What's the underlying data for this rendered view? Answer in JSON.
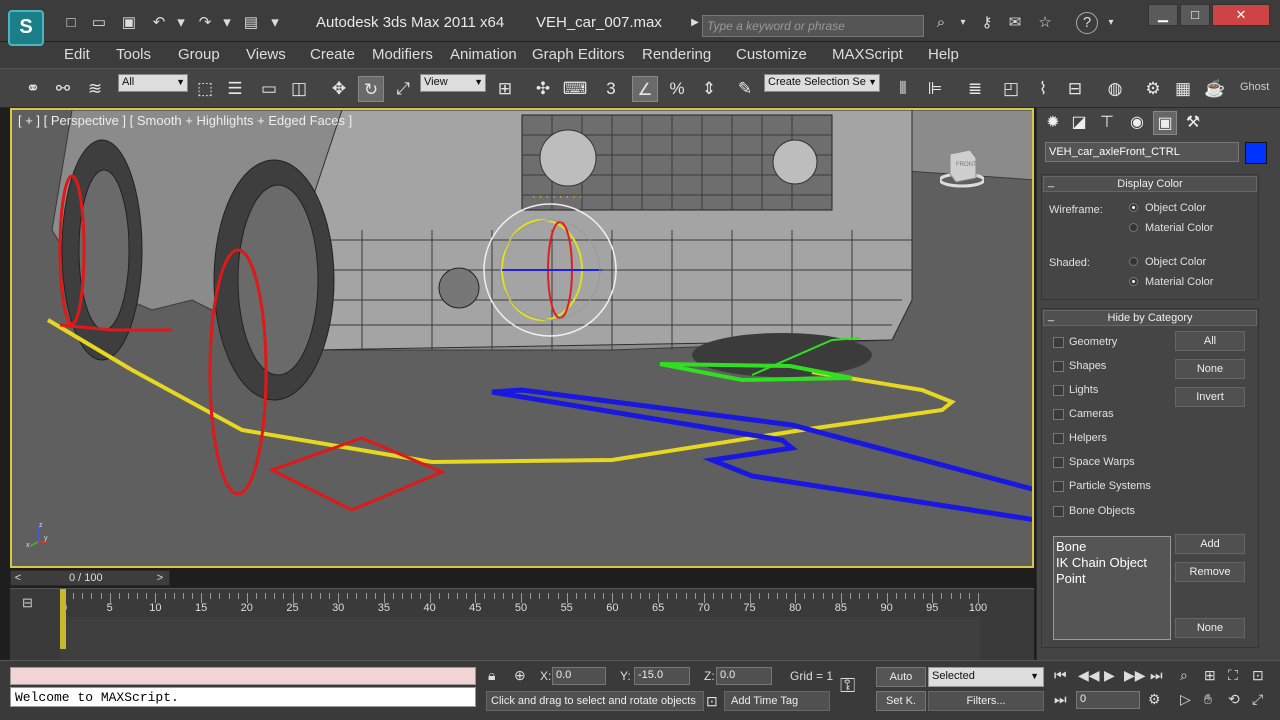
{
  "titlebar": {
    "app_logo": "S",
    "app_title": "Autodesk 3ds Max  2011 x64",
    "file_name": "VEH_car_007.max",
    "search_placeholder": "Type a keyword or phrase"
  },
  "menu": [
    "Edit",
    "Tools",
    "Group",
    "Views",
    "Create",
    "Modifiers",
    "Animation",
    "Graph Editors",
    "Rendering",
    "Customize",
    "MAXScript",
    "Help"
  ],
  "toolbar": {
    "selection_filter": "All",
    "reference_coord": "View",
    "named_selection": "Create Selection Se",
    "snap_label": "3",
    "ghost_label": "Ghost"
  },
  "viewport": {
    "label": "[ + ] [ Perspective ] [ Smooth + Highlights + Edged Faces ]",
    "viewcube_label": "FRONT",
    "axis_x": "x",
    "axis_y": "y",
    "axis_z": "z"
  },
  "command_panel": {
    "object_name": "VEH_car_axleFront_CTRL",
    "object_color": "#0033ff",
    "display_color": {
      "title": "Display Color",
      "wireframe_label": "Wireframe:",
      "shaded_label": "Shaded:",
      "object_color": "Object Color",
      "material_color": "Material Color"
    },
    "hide_by_category": {
      "title": "Hide by Category",
      "categories": [
        "Geometry",
        "Shapes",
        "Lights",
        "Cameras",
        "Helpers",
        "Space Warps",
        "Particle Systems",
        "Bone Objects"
      ],
      "all_button": "All",
      "none_button": "None",
      "invert_button": "Invert",
      "list_items": [
        "Bone",
        "IK Chain Object",
        "Point"
      ],
      "add_button": "Add",
      "remove_button": "Remove",
      "none_button_2": "None"
    }
  },
  "timeslider": {
    "position": "0 / 100",
    "prev": "<",
    "next": ">",
    "ruler": [
      "0",
      "5",
      "10",
      "15",
      "20",
      "25",
      "30",
      "35",
      "40",
      "45",
      "50",
      "55",
      "60",
      "65",
      "70",
      "75",
      "80",
      "85",
      "90",
      "95",
      "100"
    ]
  },
  "status": {
    "maxscript_output": "Welcome to MAXScript.",
    "x_label": "X:",
    "x_value": "0.0",
    "y_label": "Y:",
    "y_value": "-15.0",
    "z_label": "Z:",
    "z_value": "0.0",
    "grid": "Grid = 1",
    "prompt": "Click and drag to select and rotate objects",
    "add_time_tag": "Add Time Tag",
    "auto_key": "Auto",
    "set_key": "Set K.",
    "selected": "Selected",
    "filters": "Filters...",
    "frame": "0"
  }
}
